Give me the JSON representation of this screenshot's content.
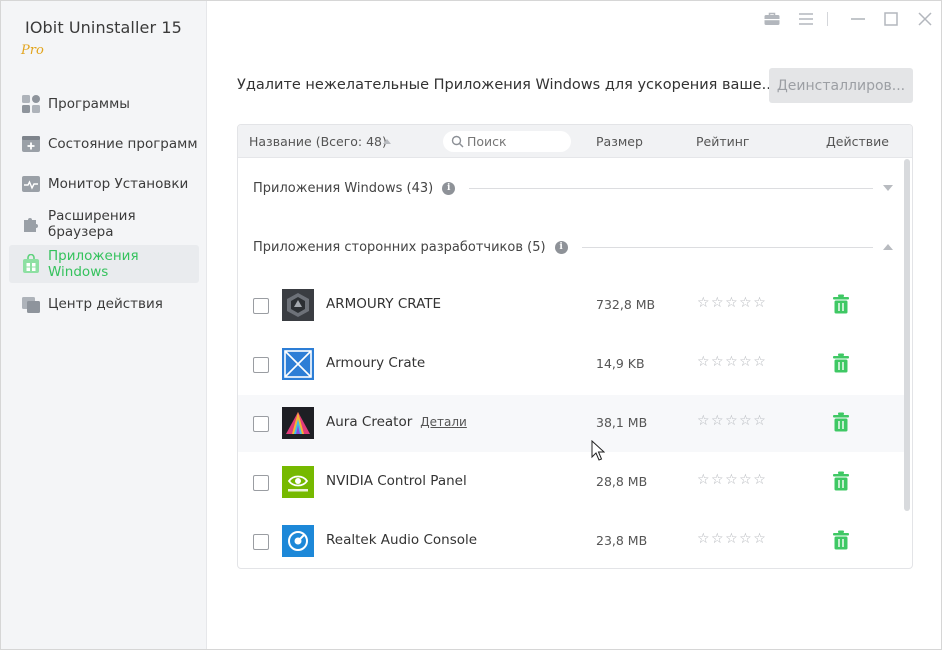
{
  "app": {
    "title": "IObit Uninstaller 15",
    "edition": "Pro"
  },
  "sidebar": {
    "items": [
      {
        "label": "Программы",
        "icon": "programs-icon",
        "active": false
      },
      {
        "label": "Состояние программ",
        "icon": "program-status-icon",
        "active": false
      },
      {
        "label": "Монитор Установки",
        "icon": "install-monitor-icon",
        "active": false
      },
      {
        "label": "Расширения браузера",
        "icon": "browser-extension-icon",
        "active": false
      },
      {
        "label": "Приложения Windows",
        "icon": "windows-apps-icon",
        "active": true
      },
      {
        "label": "Центр действия",
        "icon": "action-center-icon",
        "active": false
      }
    ]
  },
  "header": {
    "headline": "Удалите нежелательные Приложения Windows для ускорения ваше...",
    "uninstall_label": "Деинсталлиров..."
  },
  "table": {
    "columns": {
      "name": "Название (Всего: 48)",
      "size": "Размер",
      "rating": "Рейтинг",
      "action": "Действие"
    },
    "search_placeholder": "Поиск",
    "groups": [
      {
        "label": "Приложения Windows (43)",
        "expanded": false
      },
      {
        "label": "Приложения сторонних разработчиков (5)",
        "expanded": true
      }
    ],
    "rows": [
      {
        "name": "ARMOURY CRATE",
        "size": "732,8 MB",
        "stars": "☆☆☆☆☆",
        "icon": "armoury-crate-icon"
      },
      {
        "name": "Armoury Crate",
        "size": "14,9 KB",
        "stars": "☆☆☆☆☆",
        "icon": "armoury-crate-blue-icon"
      },
      {
        "name": "Aura Creator",
        "details": "Детали",
        "size": "38,1 MB",
        "stars": "☆☆☆☆☆",
        "icon": "aura-creator-icon"
      },
      {
        "name": "NVIDIA Control Panel",
        "size": "28,8 MB",
        "stars": "☆☆☆☆☆",
        "icon": "nvidia-icon"
      },
      {
        "name": "Realtek Audio Console",
        "size": "23,8 MB",
        "stars": "☆☆☆☆☆",
        "icon": "realtek-audio-icon"
      }
    ]
  },
  "colors": {
    "accent": "#35c25d",
    "pro": "#e2a41d",
    "trash": "#3fc864"
  }
}
